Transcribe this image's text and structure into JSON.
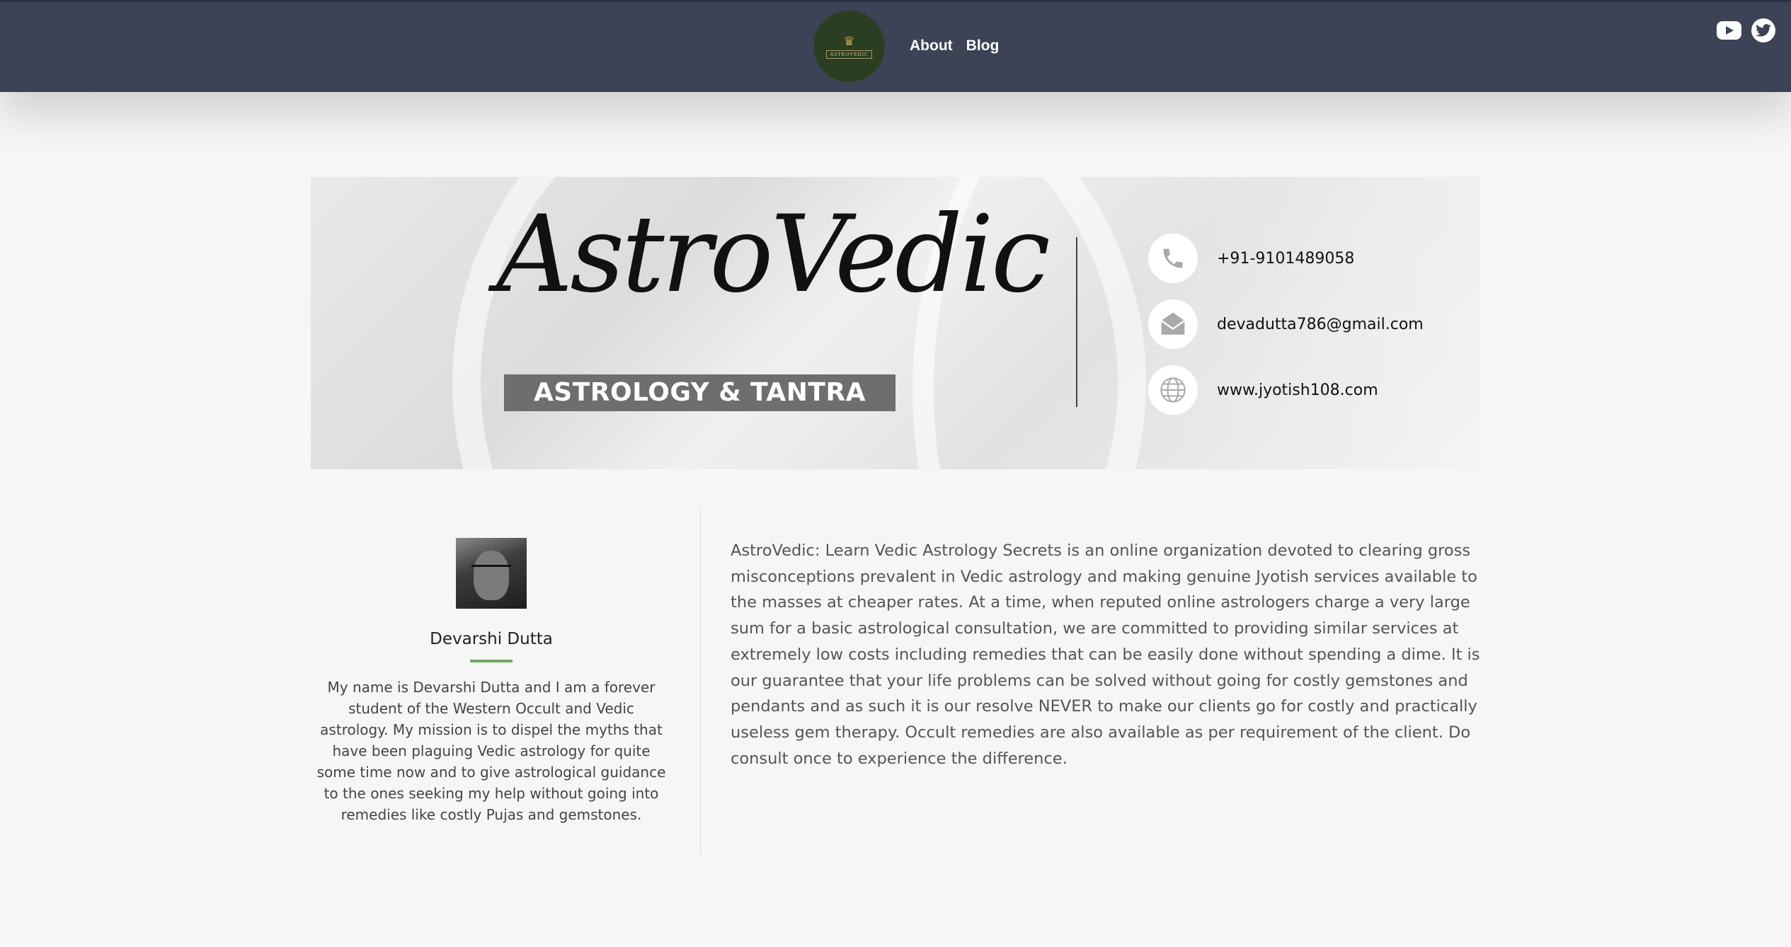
{
  "header": {
    "logo_text": "ASTROVEDIC",
    "nav": [
      {
        "label": "About"
      },
      {
        "label": "Blog"
      }
    ],
    "social": [
      {
        "icon": "youtube-icon"
      },
      {
        "icon": "twitter-icon"
      }
    ]
  },
  "banner": {
    "script_title": "AstroVedic",
    "tagline": "ASTROLOGY & TANTRA",
    "contacts": [
      {
        "icon": "phone-icon",
        "text": "+91-9101489058"
      },
      {
        "icon": "mail-icon",
        "text": "devadutta786@gmail.com"
      },
      {
        "icon": "globe-icon",
        "text": "www.jyotish108.com"
      }
    ]
  },
  "author": {
    "name": "Devarshi Dutta",
    "bio": "My name is Devarshi Dutta and I am a forever student of the Western Occult and Vedic astrology. My mission is to dispel the myths that have been plaguing Vedic astrology for quite some time now and to give astrological guidance to the ones seeking my help without going into remedies like costly Pujas and gemstones.",
    "accent_color": "#6aae5b"
  },
  "about": {
    "text": "AstroVedic: Learn Vedic Astrology Secrets is an online organization devoted to clearing gross misconceptions prevalent in Vedic astrology and making genuine Jyotish services available to the masses at cheaper rates. At a time, when reputed online astrologers charge a very large sum for a basic astrological consultation, we are committed to providing similar services at extremely low costs including remedies that can be easily done without spending a dime. It is our guarantee that your life problems can be solved without going for costly gemstones and pendants and as such it is our resolve NEVER to make our clients go for costly and practically useless gem therapy. Occult remedies are also available as per requirement of the client. Do consult once to experience the difference."
  },
  "colors": {
    "topbar": "#3d4356",
    "logo_bg": "#2a3f22",
    "page_bg": "#f6f6f6"
  }
}
